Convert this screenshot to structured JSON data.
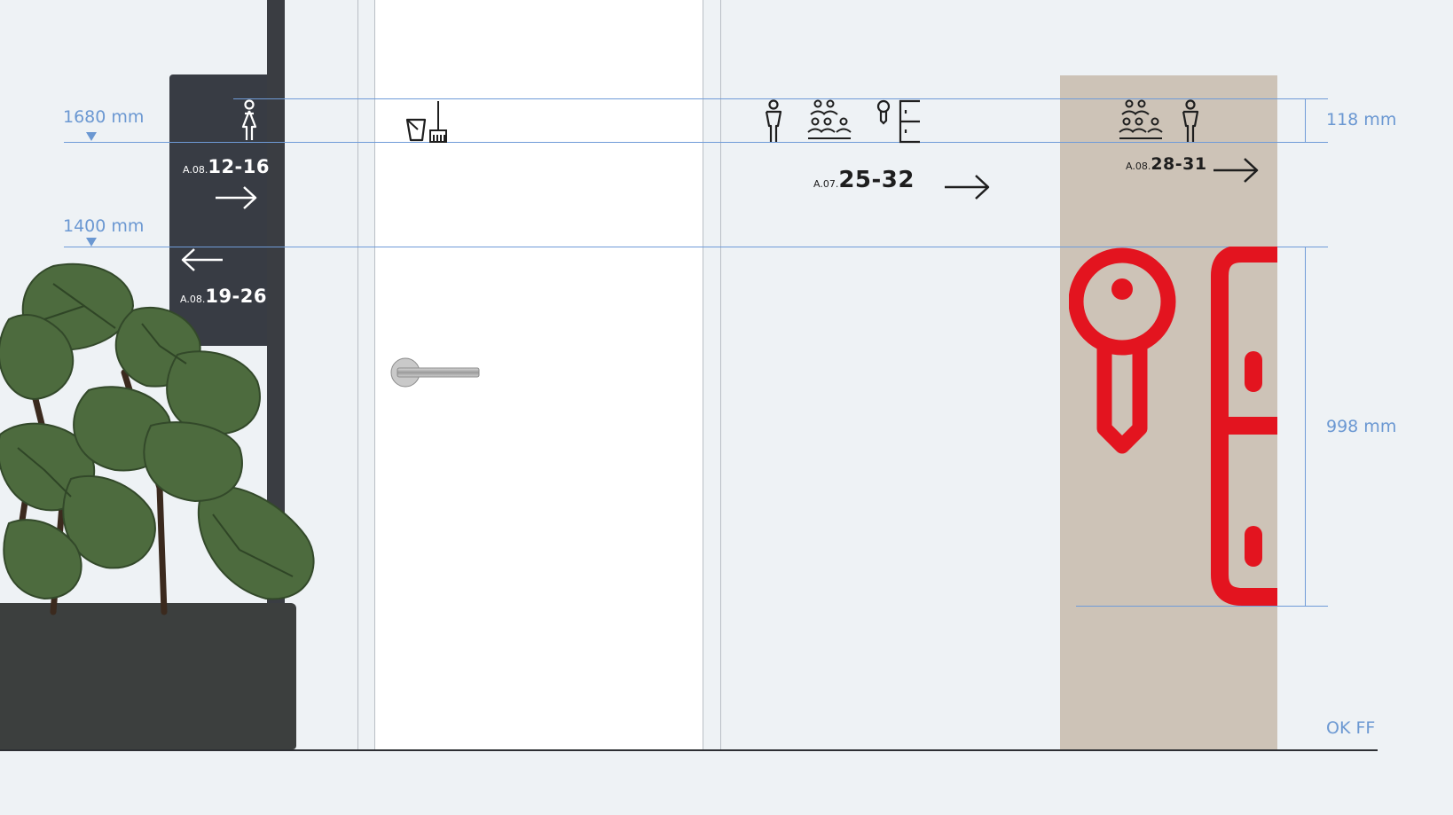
{
  "dimensions": {
    "height_1680": "1680 mm",
    "height_1400": "1400 mm",
    "sign_height_small": "118 mm",
    "sign_height_large": "998 mm"
  },
  "pole_sign": {
    "top_prefix": "A.08.",
    "top_range": "12-16",
    "top_direction": "right-arrow-icon",
    "bottom_direction": "left-arrow-icon",
    "bottom_prefix": "A.08.",
    "bottom_range": "19-26",
    "icon": "woman-icon"
  },
  "door_icons": [
    "bucket-icon",
    "broom-icon"
  ],
  "wall_sign": {
    "icons": [
      "man-icon",
      "group-icon",
      "key-door-icon"
    ],
    "prefix": "A.07.",
    "range": "25-32",
    "direction": "right-arrow-icon"
  },
  "panel_sign": {
    "icons": [
      "group-icon",
      "man-icon"
    ],
    "prefix": "A.08.",
    "range": "28-31",
    "direction": "right-arrow-icon",
    "big_icon": "key-door-icon"
  },
  "footer_label": "OK FF",
  "colors": {
    "background": "#eef2f5",
    "dimension_blue": "#6b98d2",
    "pole_sign": "#383c44",
    "panel": "#cdc3b7",
    "accent_red": "#e3141f",
    "planter": "#3c3f3e"
  }
}
